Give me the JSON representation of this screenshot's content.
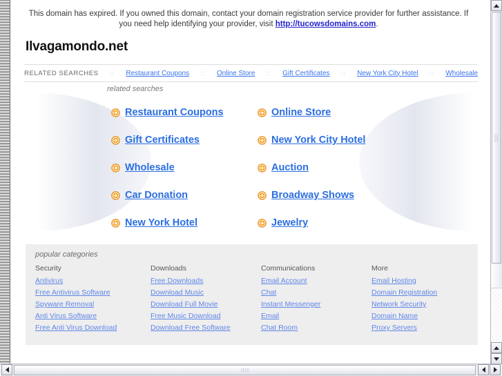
{
  "notice": {
    "text_before": "This domain has expired. If you owned this domain, contact your domain registration service provider for further assistance. If you need help identifying your provider, visit ",
    "link_text": "http://tucowsdomains.com",
    "text_after": "."
  },
  "domain_title": "Ilvagamondo.net",
  "nav": {
    "label": "RELATED SEARCHES",
    "separator": "::",
    "links": [
      "Restaurant Coupons",
      "Online Store",
      "Gift Certificates",
      "New York City Hotel",
      "Wholesale"
    ]
  },
  "related": {
    "caption": "related searches",
    "icon": "arrow-circle-icon",
    "links": [
      "Restaurant Coupons",
      "Online Store",
      "Gift Certificates",
      "New York City Hotel",
      "Wholesale",
      "Auction",
      "Car Donation",
      "Broadway Shows",
      "New York Hotel",
      "Jewelry"
    ]
  },
  "categories": {
    "caption": "popular categories",
    "columns": [
      {
        "heading": "Security",
        "links": [
          "Antivirus",
          "Free Antivirus Software",
          "Spyware Removal",
          "Anti Virus Software",
          "Free Anti Virus Download"
        ]
      },
      {
        "heading": "Downloads",
        "links": [
          "Free Downloads",
          "Download Music",
          "Download Full Movie",
          "Free Music Download",
          "Download Free Software"
        ]
      },
      {
        "heading": "Communications",
        "links": [
          "Email Account",
          "Chat",
          "Instant Messenger",
          "Email",
          "Chat Room"
        ]
      },
      {
        "heading": "More",
        "links": [
          "Email Hosting",
          "Domain Registration",
          "Network Security",
          "Domain Name",
          "Proxy Servers"
        ]
      }
    ]
  },
  "colors": {
    "link_blue": "#2b6fe0",
    "nav_blue": "#3a74e8",
    "cat_link_blue": "#5e86e8",
    "arrow_orange": "#e8890c",
    "panel_gray": "#eeeeee"
  },
  "scrollbars": {
    "vertical_icon_up": "triangle-up-icon",
    "vertical_icon_down": "triangle-down-icon",
    "horizontal_icon_left": "triangle-left-icon",
    "horizontal_icon_right": "triangle-right-icon"
  }
}
